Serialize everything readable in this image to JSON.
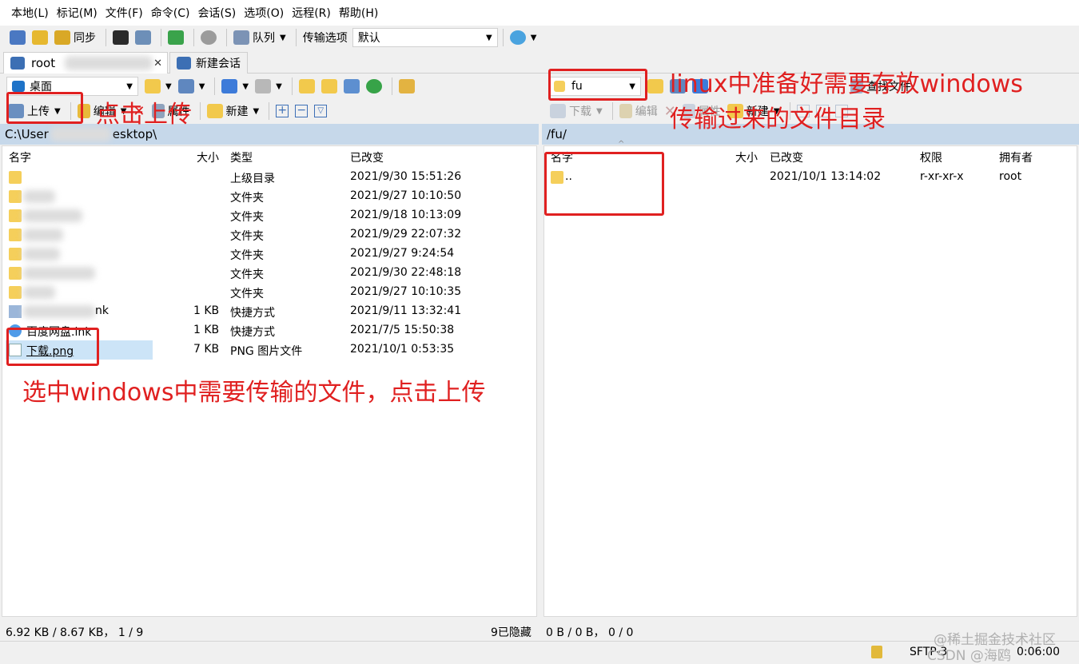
{
  "menubar": {
    "items": [
      "本地(L)",
      "标记(M)",
      "文件(F)",
      "命令(C)",
      "会话(S)",
      "选项(O)",
      "远程(R)",
      "帮助(H)"
    ]
  },
  "toolbar": {
    "sync_label": "同步",
    "queue_label": "队列",
    "transfer_options_label": "传输选项",
    "transfer_options_value": "默认"
  },
  "tabs": {
    "session_label": "root",
    "new_session_label": "新建会话"
  },
  "left": {
    "location": "桌面",
    "upload_label": "上传",
    "edit_label": "编辑",
    "properties_label": "属性",
    "new_label": "新建",
    "path": "C:\\User",
    "path_tail": "esktop\\",
    "columns": [
      "名字",
      "大小",
      "类型",
      "已改变"
    ],
    "rows": [
      {
        "name": "",
        "size": "",
        "type": "上级目录",
        "changed": "2021/9/30  15:51:26"
      },
      {
        "name": "",
        "size": "",
        "type": "文件夹",
        "changed": "2021/9/27  10:10:50"
      },
      {
        "name": "",
        "size": "",
        "type": "文件夹",
        "changed": "2021/9/18  10:13:09"
      },
      {
        "name": "",
        "size": "",
        "type": "文件夹",
        "changed": "2021/9/29  22:07:32"
      },
      {
        "name": "",
        "size": "",
        "type": "文件夹",
        "changed": "2021/9/27  9:24:54"
      },
      {
        "name": "",
        "size": "",
        "type": "文件夹",
        "changed": "2021/9/30  22:48:18"
      },
      {
        "name": "",
        "size": "",
        "type": "文件夹",
        "changed": "2021/9/27  10:10:35"
      },
      {
        "name": "nk",
        "size": "1 KB",
        "type": "快捷方式",
        "changed": "2021/9/11  13:32:41"
      },
      {
        "name": "百度网盘.lnk",
        "size": "1 KB",
        "type": "快捷方式",
        "changed": "2021/7/5  15:50:38"
      },
      {
        "name": "下载.png",
        "size": "7 KB",
        "type": "PNG 图片文件",
        "changed": "2021/10/1  0:53:35"
      }
    ],
    "status": "6.92 KB / 8.67 KB， 1 / 9",
    "hidden": "9已隐藏"
  },
  "right": {
    "location": "fu",
    "download_label": "下载",
    "edit_label": "编辑",
    "properties_label": "属性",
    "new_label": "新建",
    "find_label": "查找文件",
    "path": "/fu/",
    "columns": [
      "名字",
      "大小",
      "已改变",
      "权限",
      "拥有者"
    ],
    "rows": [
      {
        "name": "..",
        "size": "",
        "changed": "2021/10/1 13:14:02",
        "rights": "r-xr-xr-x",
        "owner": "root"
      }
    ],
    "status": "0 B / 0 B， 0 / 0"
  },
  "bottom": {
    "protocol": "SFTP-3",
    "time": "0:06:00"
  },
  "annotations": {
    "click_upload": "点击上传",
    "linux_dir_line1": "linux中准备好需要存放windows",
    "linux_dir_line2": "传输过来的文件目录",
    "select_file": "选中windows中需要传输的文件，点击上传"
  },
  "watermark": {
    "line1": "@稀土掘金技术社区",
    "line2": "CSDN @海鸥"
  },
  "colors": {
    "annotation": "#e02020",
    "path_bar": "#c6d8ea",
    "selected_row": "#cce4f7",
    "folder": "#f5cf5b"
  }
}
